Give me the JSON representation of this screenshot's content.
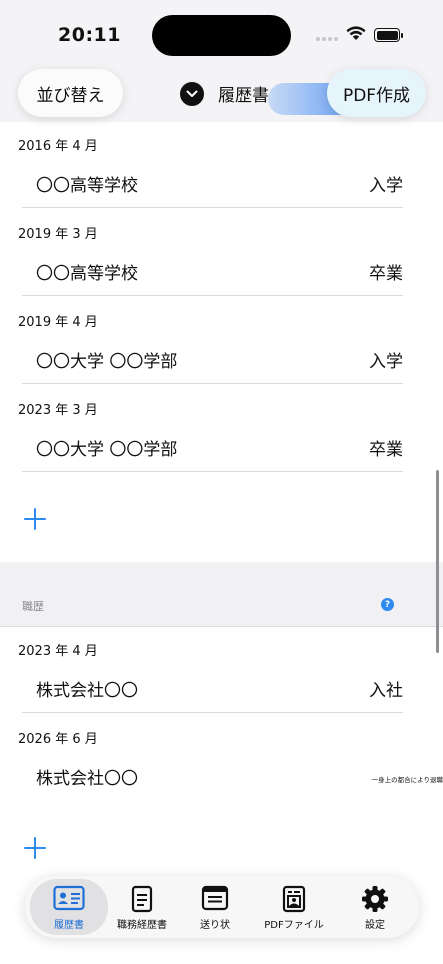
{
  "status_bar": {
    "time": "20:11"
  },
  "nav": {
    "sort_label": "並び替え",
    "title": "履歴書",
    "pdf_label": "PDF作成"
  },
  "education": [
    {
      "date": "2016 年 4 月",
      "name": "〇〇高等学校",
      "status": "入学"
    },
    {
      "date": "2019 年 3 月",
      "name": "〇〇高等学校",
      "status": "卒業"
    },
    {
      "date": "2019 年 4 月",
      "name": "〇〇大学 〇〇学部",
      "status": "入学"
    },
    {
      "date": "2023 年 3 月",
      "name": "〇〇大学 〇〇学部",
      "status": "卒業"
    }
  ],
  "work_section": {
    "title": "職歴",
    "help": "?"
  },
  "work": [
    {
      "date": "2023 年 4 月",
      "name": "株式会社〇〇",
      "status": "入社"
    },
    {
      "date": "2026 年 6 月",
      "name": "株式会社〇〇",
      "status": "一身上の都合により退職"
    }
  ],
  "tabs": [
    {
      "label": "履歴書",
      "icon": "resume-card-icon",
      "active": true
    },
    {
      "label": "職務経歴書",
      "icon": "document-icon",
      "active": false
    },
    {
      "label": "送り状",
      "icon": "letter-icon",
      "active": false
    },
    {
      "label": "PDFファイル",
      "icon": "pdf-file-icon",
      "active": false
    },
    {
      "label": "設定",
      "icon": "gear-icon",
      "active": false
    }
  ],
  "colors": {
    "accent": "#2d8af0",
    "active_tab": "#1f6fd6"
  }
}
